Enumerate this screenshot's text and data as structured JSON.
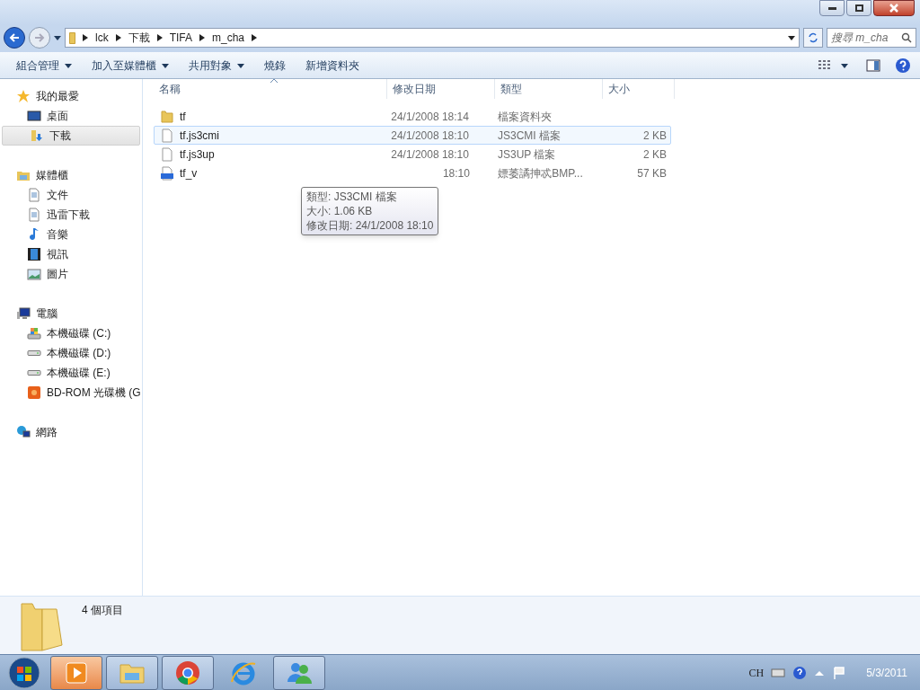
{
  "address_bar": {
    "crumbs": [
      "lck",
      "下載",
      "TIFA",
      "m_cha"
    ]
  },
  "search": {
    "placeholder": "搜尋 m_cha"
  },
  "toolbar": {
    "items": [
      {
        "label": "組合管理",
        "dropdown": true
      },
      {
        "label": "加入至媒體櫃",
        "dropdown": true
      },
      {
        "label": "共用對象",
        "dropdown": true
      },
      {
        "label": "燒錄",
        "dropdown": false
      },
      {
        "label": "新增資料夾",
        "dropdown": false
      }
    ]
  },
  "sidebar": {
    "groups": [
      {
        "label": "我的最愛",
        "kind": "star",
        "selected": false,
        "children": [
          {
            "label": "桌面",
            "kind": "desktop",
            "selected": false
          },
          {
            "label": "下載",
            "kind": "download",
            "selected": true
          }
        ]
      },
      {
        "label": "媒體櫃",
        "kind": "library",
        "selected": false,
        "children": [
          {
            "label": "文件",
            "kind": "document",
            "selected": false
          },
          {
            "label": "迅雷下載",
            "kind": "document",
            "selected": false
          },
          {
            "label": "音樂",
            "kind": "music",
            "selected": false
          },
          {
            "label": "視訊",
            "kind": "video",
            "selected": false
          },
          {
            "label": "圖片",
            "kind": "picture",
            "selected": false
          }
        ]
      },
      {
        "label": "電腦",
        "kind": "computer",
        "selected": false,
        "children": [
          {
            "label": "本機磁碟 (C:)",
            "kind": "system-drive",
            "selected": false
          },
          {
            "label": "本機磁碟 (D:)",
            "kind": "drive",
            "selected": false
          },
          {
            "label": "本機磁碟 (E:)",
            "kind": "drive",
            "selected": false
          },
          {
            "label": "BD-ROM 光碟機 (G",
            "kind": "optical",
            "selected": false
          }
        ]
      },
      {
        "label": "網路",
        "kind": "network",
        "selected": false
      }
    ]
  },
  "table": {
    "columns": [
      {
        "label": "名稱",
        "sorted": true
      },
      {
        "label": "修改日期",
        "sorted": false
      },
      {
        "label": "類型",
        "sorted": false
      },
      {
        "label": "大小",
        "sorted": false
      }
    ],
    "rows": [
      {
        "name": "tf",
        "kind": "folder",
        "date": "24/1/2008 18:14",
        "type": "檔案資料夾",
        "size": "",
        "selected": false
      },
      {
        "name": "tf.js3cmi",
        "kind": "file",
        "date": "24/1/2008 18:10",
        "type": "JS3CMI 檔案",
        "size": "2 KB",
        "selected": true
      },
      {
        "name": "tf.js3up",
        "kind": "file",
        "date": "24/1/2008 18:10",
        "type": "JS3UP 檔案",
        "size": "2 KB",
        "selected": false
      },
      {
        "name": "tf_v",
        "kind": "bmp",
        "date": "18:10",
        "type": "嫖萎譎抻忒BMP...",
        "size": "57 KB",
        "selected": false
      }
    ]
  },
  "tooltip": {
    "lines": [
      "類型: JS3CMI 檔案",
      "大小: 1.06 KB",
      "修改日期: 24/1/2008 18:10"
    ]
  },
  "details": {
    "text": "4 個項目"
  },
  "taskbar": {
    "apps": [
      {
        "kind": "media",
        "running": true,
        "active": true
      },
      {
        "kind": "explorer",
        "running": true,
        "active": false
      },
      {
        "kind": "chrome",
        "running": true,
        "active": false
      },
      {
        "kind": "ie",
        "running": false,
        "active": false
      },
      {
        "kind": "messenger",
        "running": true,
        "active": false
      }
    ],
    "language": "CH",
    "date": "5/3/2011"
  }
}
